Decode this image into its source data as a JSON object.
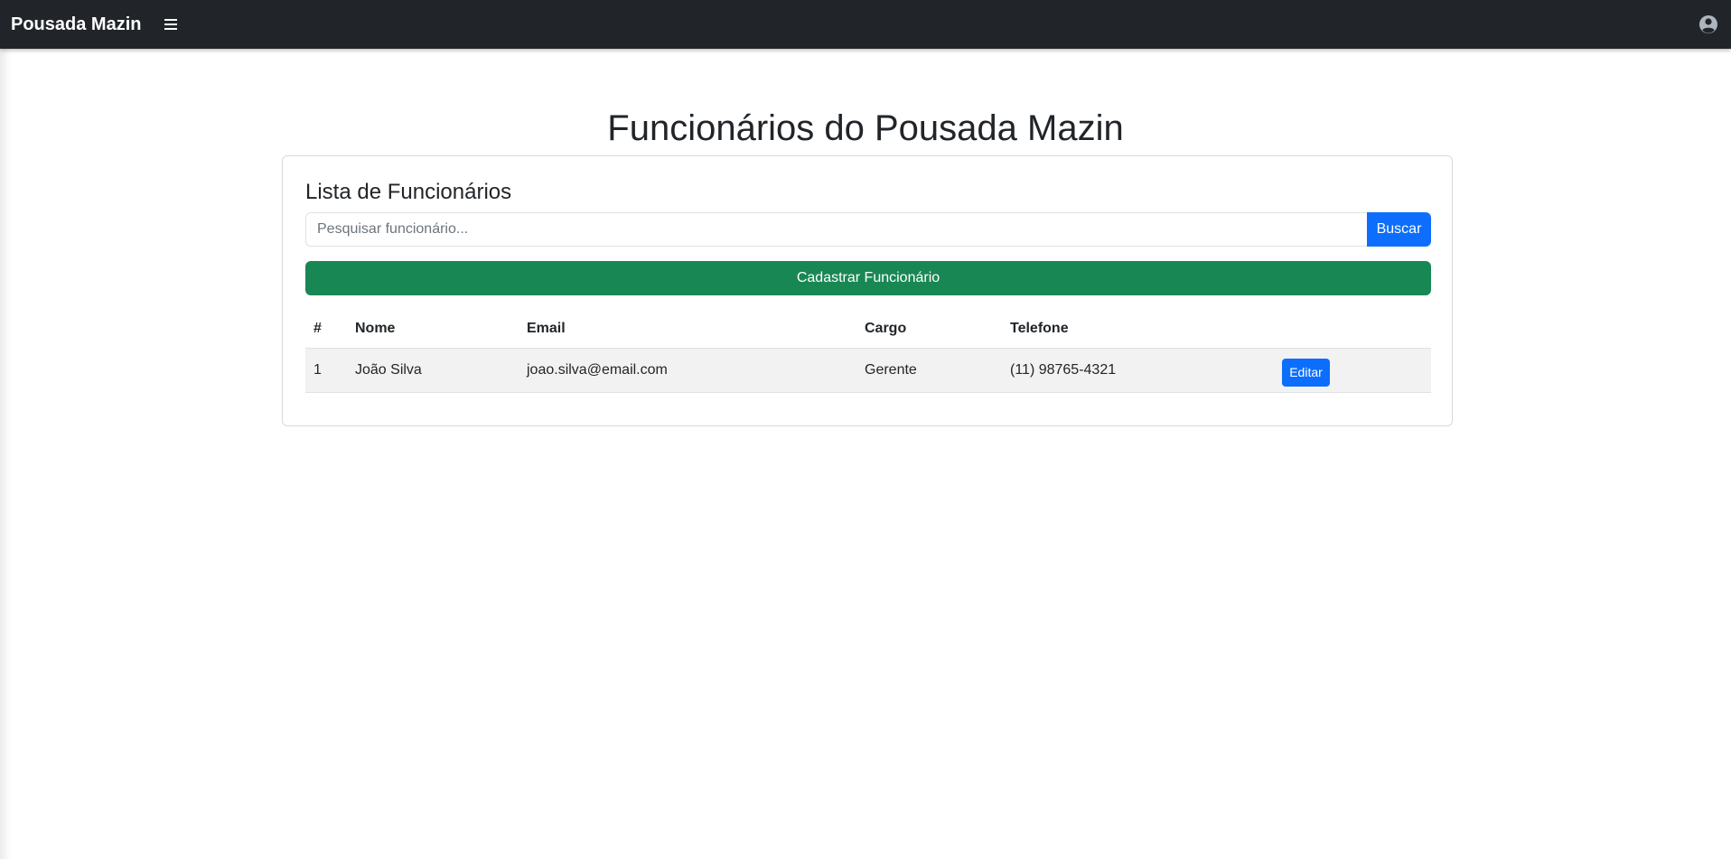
{
  "navbar": {
    "brand": "Pousada Mazin",
    "menu_icon": "hamburger-icon",
    "user_icon": "user-circle-icon",
    "background": "#212529"
  },
  "page": {
    "title": "Funcionários do Pousada Mazin"
  },
  "card": {
    "title": "Lista de Funcionários",
    "search": {
      "placeholder": "Pesquisar funcionário...",
      "value": "",
      "button_label": "Buscar"
    },
    "register_button_label": "Cadastrar Funcionário",
    "table": {
      "columns": [
        "#",
        "Nome",
        "Email",
        "Cargo",
        "Telefone",
        ""
      ],
      "rows": [
        {
          "id": "1",
          "name": "João Silva",
          "email": "joao.silva@email.com",
          "role": "Gerente",
          "phone": "(11) 98765-4321",
          "action_label": "Editar"
        }
      ]
    }
  },
  "colors": {
    "primary": "#0d6efd",
    "success": "#198754",
    "dark": "#212529"
  }
}
